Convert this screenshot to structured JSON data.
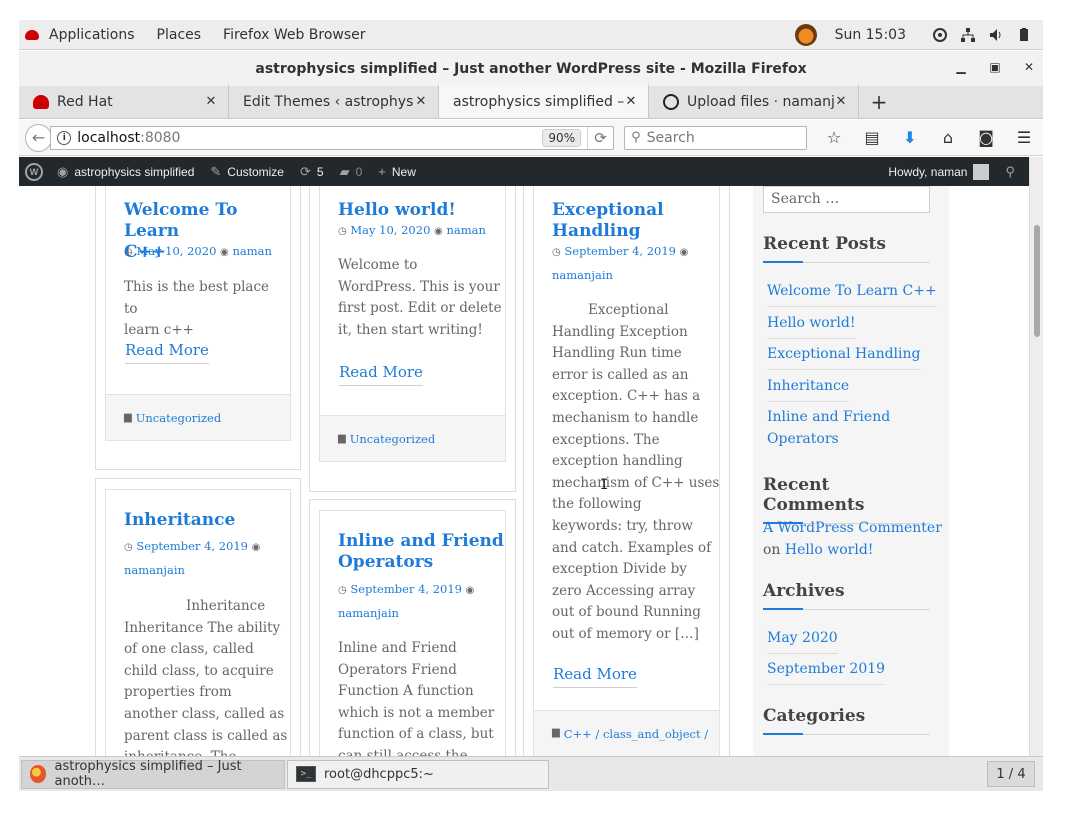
{
  "top_panel": {
    "applications": "Applications",
    "places": "Places",
    "active_app": "Firefox Web Browser",
    "clock": "Sun 15:03"
  },
  "window": {
    "title": "astrophysics simplified – Just another WordPress site - Mozilla Firefox"
  },
  "tabs": [
    {
      "label": "Red Hat"
    },
    {
      "label": "Edit Themes ‹ astrophysic…"
    },
    {
      "label": "astrophysics simplified – …"
    },
    {
      "label": "Upload files · namanja…"
    }
  ],
  "navbar": {
    "url_host": "localhost",
    "url_port": ":8080",
    "zoom": "90%",
    "search_placeholder": "Search"
  },
  "wp_admin_bar": {
    "site_name": "astrophysics simplified",
    "customize": "Customize",
    "updates_count": "5",
    "comments_count": "0",
    "new_label": "New",
    "howdy": "Howdy, naman"
  },
  "posts": {
    "p1": {
      "title_line1": "Welcome To Learn",
      "title_line2": "C++",
      "date": "May 10, 2020",
      "author": "naman",
      "excerpt_l1": "This is the best place to",
      "excerpt_l2": "learn c++",
      "read_more": "Read More",
      "category": "Uncategorized"
    },
    "p2": {
      "title": "Hello world!",
      "date": "May 10, 2020",
      "author": "naman",
      "excerpt": [
        "Welcome to",
        "WordPress. This is your",
        "first post. Edit or delete",
        "it, then start writing!"
      ],
      "read_more": "Read More",
      "category": "Uncategorized"
    },
    "p3": {
      "title_line1": "Exceptional",
      "title_line2": "Handling",
      "date": "September 4, 2019",
      "author": "namanjain",
      "excerpt": [
        "Exceptional",
        "Handling Exception",
        "Handling Run time",
        "error is called as an",
        "exception. C++ has a",
        "mechanism to handle",
        "exceptions. The",
        "exception handling",
        "mechanism of C++ uses",
        "the following",
        "keywords: try, throw",
        "and catch. Examples of",
        "exception Divide by",
        "zero Accessing array",
        "out of bound Running",
        "out of memory or […]"
      ],
      "read_more": "Read More",
      "category": "C++ / class_and_object /"
    },
    "p4": {
      "title": "Inheritance",
      "date": "September 4, 2019",
      "author": "namanjain",
      "excerpt": [
        "Inheritance",
        "Inheritance The ability",
        "of one class, called",
        "child class, to acquire",
        "properties from",
        "another class, called as",
        "parent class is called as",
        "inheritance. The"
      ]
    },
    "p5": {
      "title_line1": "Inline and Friend",
      "title_line2": "Operators",
      "date": "September 4, 2019",
      "author": "namanjain",
      "excerpt": [
        "Inline and Friend",
        "Operators  Friend",
        "Function A function",
        "which is not a member",
        "function of a class, but",
        "can still access the"
      ]
    }
  },
  "sidebar": {
    "search_placeholder": "Search …",
    "recent_posts_title": "Recent Posts",
    "recent_posts": [
      "Welcome To Learn C++",
      "Hello world!",
      "Exceptional Handling",
      "Inheritance",
      "Inline and Friend",
      "Operators"
    ],
    "recent_comments_title": "Recent Comments",
    "comment_author": "A WordPress Commenter",
    "comment_on": "on",
    "comment_post": "Hello world!",
    "archives_title": "Archives",
    "archives": [
      "May 2020",
      "September 2019"
    ],
    "categories_title": "Categories"
  },
  "taskbar": {
    "task1": "astrophysics simplified – Just anoth…",
    "task2": "root@dhcppc5:~",
    "workspace": "1 / 4"
  },
  "colors": {
    "link": "#1e7bd8",
    "wpbar": "#23282d",
    "sidebar_bg": "#f5f5f5"
  },
  "icons": [
    "redhat-icon",
    "firefox-icon",
    "terminal-icon",
    "github-icon",
    "wordpress-icon",
    "search-icon",
    "bookmark-star-icon",
    "download-icon",
    "home-icon",
    "pocket-icon",
    "hamburger-menu-icon",
    "clock-icon",
    "user-icon",
    "folder-icon"
  ]
}
